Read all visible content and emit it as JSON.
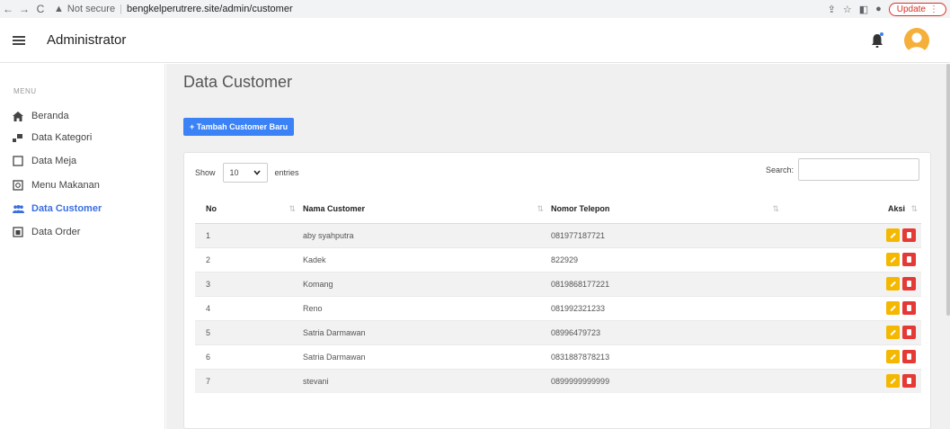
{
  "browser": {
    "security_label": "Not secure",
    "url": "bengkelperutrere.site/admin/customer",
    "update_label": "Update"
  },
  "header": {
    "app_title": "Administrator"
  },
  "sidebar": {
    "menu_label": "MENU",
    "items": [
      {
        "label": "Beranda",
        "icon": "home-icon"
      },
      {
        "label": "Data Kategori",
        "icon": "chart-icon"
      },
      {
        "label": "Data Meja",
        "icon": "table-icon"
      },
      {
        "label": "Menu Makanan",
        "icon": "food-menu-icon"
      },
      {
        "label": "Data Customer",
        "icon": "users-icon",
        "active": true
      },
      {
        "label": "Data Order",
        "icon": "order-icon"
      }
    ]
  },
  "main": {
    "title": "Data Customer",
    "add_button": "+ Tambah Customer Baru",
    "show_label": "Show",
    "entries_value": "10",
    "entries_label": "entries",
    "search_label": "Search:",
    "columns": [
      "No",
      "Nama Customer",
      "Nomor Telepon",
      "Aksi"
    ],
    "rows": [
      {
        "no": "1",
        "name": "aby syahputra",
        "phone": "081977187721"
      },
      {
        "no": "2",
        "name": "Kadek",
        "phone": "822929"
      },
      {
        "no": "3",
        "name": "Komang",
        "phone": "0819868177221"
      },
      {
        "no": "4",
        "name": "Reno",
        "phone": "081992321233"
      },
      {
        "no": "5",
        "name": "Satria Darmawan",
        "phone": "08996479723"
      },
      {
        "no": "6",
        "name": "Satria Darmawan",
        "phone": "0831887878213"
      },
      {
        "no": "7",
        "name": "stevani",
        "phone": "0899999999999"
      }
    ]
  },
  "colors": {
    "primary": "#3b82f6",
    "edit": "#f5b800",
    "delete": "#e53935",
    "active_nav": "#3b6fe0"
  }
}
